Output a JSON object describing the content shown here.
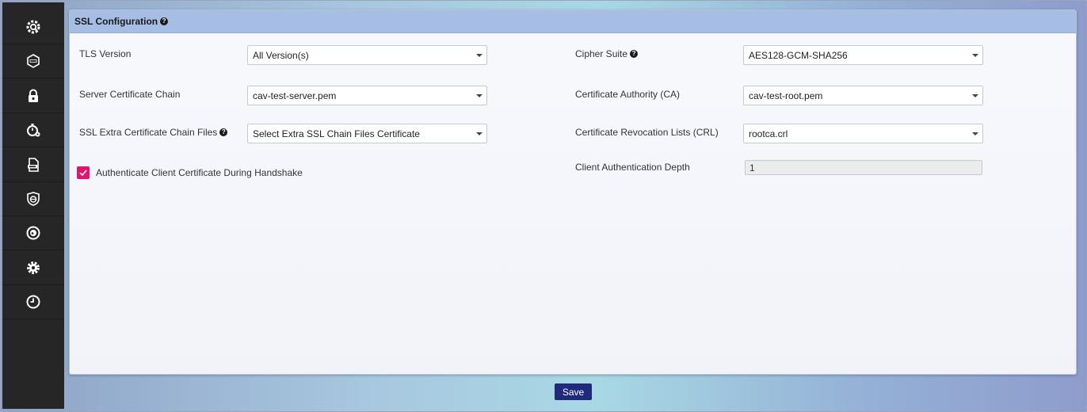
{
  "panel": {
    "title": "SSL Configuration"
  },
  "sidebar": {
    "items": [
      {
        "icon": "search-gear-icon"
      },
      {
        "icon": "hexagon-icon"
      },
      {
        "icon": "lock-icon"
      },
      {
        "icon": "stopwatch-gear-icon"
      },
      {
        "icon": "document-icon"
      },
      {
        "icon": "shield-icon"
      },
      {
        "icon": "disc-icon"
      },
      {
        "icon": "gear-icon"
      },
      {
        "icon": "clock-icon"
      }
    ]
  },
  "form": {
    "tls_version": {
      "label": "TLS Version",
      "value": "All Version(s)"
    },
    "server_cert_chain": {
      "label": "Server Certificate Chain",
      "value": "cav-test-server.pem"
    },
    "extra_chain_files": {
      "label": "SSL Extra Certificate Chain Files",
      "value": "Select Extra SSL Chain Files Certificate"
    },
    "auth_client_cert": {
      "label": "Authenticate Client Certificate During Handshake",
      "checked": true
    },
    "cipher_suite": {
      "label": "Cipher Suite",
      "value": "AES128-GCM-SHA256"
    },
    "cert_authority": {
      "label": "Certificate Authority (CA)",
      "value": "cav-test-root.pem"
    },
    "crl": {
      "label": "Certificate Revocation Lists (CRL)",
      "value": "rootca.crl"
    },
    "client_auth_depth": {
      "label": "Client Authentication Depth",
      "value": "1"
    }
  },
  "actions": {
    "save_label": "Save"
  },
  "colors": {
    "sidebar_bg": "#262626",
    "header_bg": "#a6bde4",
    "checkbox": "#e5136e",
    "save_button": "#1f2a7a"
  }
}
